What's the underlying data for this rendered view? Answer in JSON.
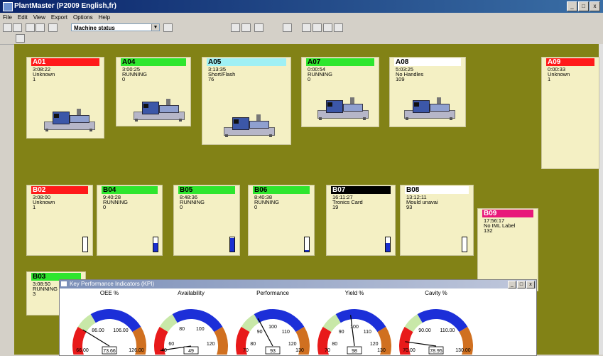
{
  "window": {
    "title": "PlantMaster (P2009 English,fr)",
    "min": "_",
    "max": "□",
    "close": "x"
  },
  "menu": [
    "File",
    "Edit",
    "View",
    "Export",
    "Options",
    "Help"
  ],
  "toolbar": {
    "view_select": "Machine status",
    "arrow": "▾"
  },
  "machines": [
    {
      "id": "A01",
      "time": "3:08:22",
      "status": "Unknown",
      "count": "1",
      "color": "#ff1a1a",
      "text": "#ffffff"
    },
    {
      "id": "A04",
      "time": "3:00:25",
      "status": "RUNNING",
      "count": "0",
      "color": "#2ee62e",
      "text": "#000000"
    },
    {
      "id": "A05",
      "time": "3:13:35",
      "status": "Short/Flash",
      "count": "76",
      "color": "#9ff0f4",
      "text": "#000000"
    },
    {
      "id": "A07",
      "time": "0:00:54",
      "status": "RUNNING",
      "count": "0",
      "color": "#2ee62e",
      "text": "#000000"
    },
    {
      "id": "A08",
      "time": "5:03:25",
      "status": "No Handles",
      "count": "109",
      "color": "#ffffff",
      "text": "#000000"
    },
    {
      "id": "A09",
      "time": "0:00:33",
      "status": "Unknown",
      "count": "1",
      "color": "#ff1a1a",
      "text": "#ffffff"
    },
    {
      "id": "B02",
      "time": "3:08:00",
      "status": "Unknown",
      "count": "1",
      "color": "#ff1a1a",
      "text": "#ffffff",
      "fill": 0
    },
    {
      "id": "B04",
      "time": "9:40:28",
      "status": "RUNNING",
      "count": "0",
      "color": "#2ee62e",
      "text": "#000000",
      "fill": 0.6
    },
    {
      "id": "B05",
      "time": "8:48:36",
      "status": "RUNNING",
      "count": "0",
      "color": "#2ee62e",
      "text": "#000000",
      "fill": 0.95
    },
    {
      "id": "B06",
      "time": "8:40:38",
      "status": "RUNNING",
      "count": "0",
      "color": "#2ee62e",
      "text": "#000000",
      "fill": 0.1
    },
    {
      "id": "B07",
      "time": "16:11:27",
      "status": "Tronics Card",
      "count": "19",
      "color": "#000000",
      "text": "#ffffff",
      "fill": 0.6
    },
    {
      "id": "B08",
      "time": "13:12:11",
      "status": "Mould unavai",
      "count": "93",
      "color": "#ffffff",
      "text": "#000000",
      "fill": 0
    },
    {
      "id": "B09",
      "time": "17:56:17",
      "status": "No IML Label",
      "count": "132",
      "color": "#e8187a",
      "text": "#ffffff"
    },
    {
      "id": "B03",
      "time": "3:08:50",
      "status": "RUNNING",
      "count": "3",
      "color": "#2ee62e",
      "text": "#000000"
    }
  ],
  "kpi": {
    "title": "Key Performance Indicators (KPI)",
    "min": "_",
    "max": "□",
    "close": "x",
    "gauges": [
      {
        "name": "OEE %",
        "left_val": "66.00",
        "value_box": "73.66",
        "right_val": "126.00",
        "inner_left": "86.00",
        "inner_right": "106.00",
        "needle": 0.25
      },
      {
        "name": "Availability",
        "left_val": "40",
        "value_box": "49",
        "right_val": "",
        "ticks": [
          "60",
          "80",
          "100",
          "120"
        ],
        "needle": 0.08
      },
      {
        "name": "Performance",
        "left_val": "70",
        "value_box": "93",
        "right_val": "130",
        "ticks": [
          "80",
          "90",
          "100",
          "110",
          "120"
        ],
        "needle": 0.38
      },
      {
        "name": "Yield %",
        "left_val": "70",
        "value_box": "98",
        "right_val": "130",
        "ticks": [
          "80",
          "90",
          "100",
          "110",
          "120"
        ],
        "needle": 0.47
      },
      {
        "name": "Cavity %",
        "left_val": "70.00",
        "value_box": "78.95",
        "right_val": "130.00",
        "inner_left": "90.00",
        "inner_right": "110.00",
        "needle": 0.15
      }
    ]
  }
}
